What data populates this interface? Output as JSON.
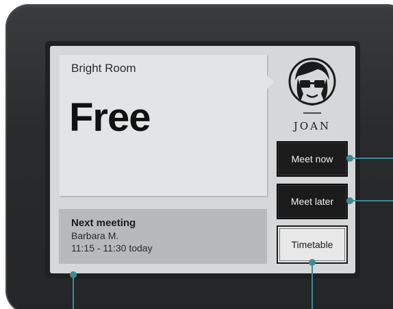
{
  "room": {
    "name": "Bright Room",
    "status": "Free"
  },
  "next_meeting": {
    "title": "Next meeting",
    "person": "Barbara M.",
    "time": "11:15 - 11:30 today"
  },
  "logo": {
    "word": "JOAN"
  },
  "buttons": {
    "meet_now": "Meet now",
    "meet_later": "Meet later",
    "timetable": "Timetable"
  },
  "colors": {
    "device_frame": "#2a2b2d",
    "screen": "#d6d7d8",
    "callout_line": "#3f8a93"
  }
}
